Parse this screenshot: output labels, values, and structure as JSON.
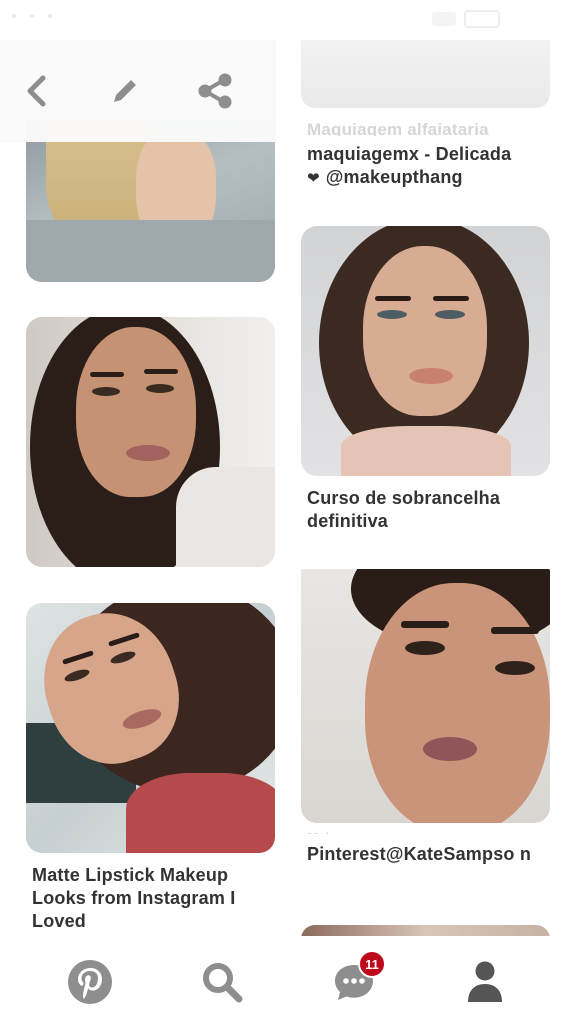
{
  "colors": {
    "accent": "#bd081c",
    "text": "#333333",
    "icon_gray": "#8e8e8e",
    "icon_dark": "#555555"
  },
  "top_bar": {
    "back_icon": "chevron-left-icon",
    "edit_icon": "pencil-icon",
    "share_icon": "share-icon"
  },
  "pins": {
    "pin_1": {
      "image": "blonde-hand-photo"
    },
    "pin_2": {
      "faded_caption": "Maquiagem alfaiataria",
      "caption_line1": "maquiagemx - Delicada",
      "caption_line2": "@makeupthang"
    },
    "pin_3": {
      "image": "brunette-long-hair-photo"
    },
    "pin_4": {
      "image": "brunette-straight-hair-photo",
      "caption": "Curso de sobrancelha definitiva"
    },
    "pin_5": {
      "image": "selfie-red-sweater-photo",
      "caption": "Matte Lipstick Makeup Looks from Instagram I Loved"
    },
    "pin_6": {
      "image": "smoky-eye-closeup-photo",
      "faded_caption": "Makeup",
      "caption": "Pinterest@KateSampso n"
    }
  },
  "tab_bar": {
    "home_icon": "pinterest-logo-icon",
    "search_icon": "search-icon",
    "messages_icon": "chat-bubble-icon",
    "messages_badge": "11",
    "profile_icon": "person-icon"
  }
}
